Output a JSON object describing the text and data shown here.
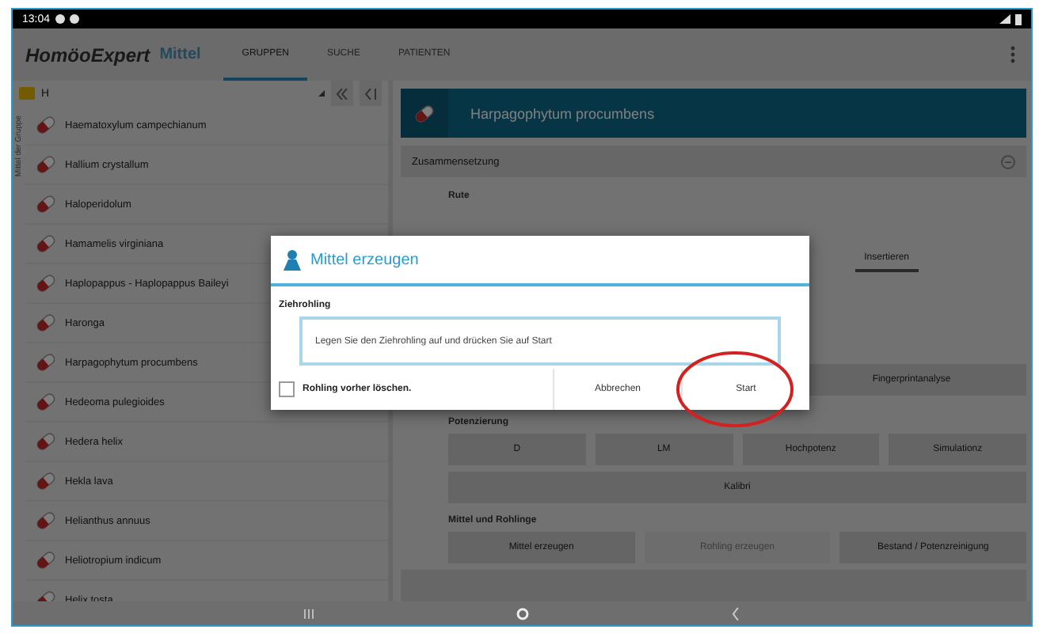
{
  "status_bar": {
    "time": "13:04"
  },
  "app_bar": {
    "logo": "HomöoExpert",
    "subtitle": "Mittel",
    "tabs": [
      {
        "label": "GRUPPEN",
        "selected": true
      },
      {
        "label": "SUCHE",
        "selected": false
      },
      {
        "label": "PATIENTEN",
        "selected": false
      }
    ]
  },
  "group_panel": {
    "side_label": "Mittel der Gruppe",
    "group": "H",
    "items": [
      {
        "label": "Haematoxylum campechianum"
      },
      {
        "label": "Hallium crystallum"
      },
      {
        "label": "Haloperidolum"
      },
      {
        "label": "Hamamelis virginiana"
      },
      {
        "label": "Haplopappus - Haplopappus Baileyi"
      },
      {
        "label": "Haronga"
      },
      {
        "label": "Harpagophytum procumbens"
      },
      {
        "label": "Hedeoma pulegioides"
      },
      {
        "label": "Hedera helix"
      },
      {
        "label": "Hekla lava"
      },
      {
        "label": "Helianthus annuus"
      },
      {
        "label": "Heliotropium indicum"
      },
      {
        "label": "Helix tosta"
      }
    ]
  },
  "detail": {
    "title": "Harpagophytum procumbens",
    "section": "Zusammensetzung",
    "field_label": "Rute",
    "tab": "Insertieren",
    "analysis_button": "Fingerprintanalyse",
    "potency_label": "Potenzierung",
    "potency_buttons": [
      "D",
      "LM",
      "Hochpotenz",
      "Simulationz"
    ],
    "wide_button": "Kalibri",
    "remedy_label": "Mittel und Rohlinge",
    "remedy_buttons": [
      {
        "label": "Mittel erzeugen",
        "disabled": false
      },
      {
        "label": "Rohling erzeugen",
        "disabled": true
      },
      {
        "label": "Bestand / Potenzreinigung",
        "disabled": false
      }
    ]
  },
  "dialog": {
    "title": "Mittel erzeugen",
    "field_label": "Ziehrohling",
    "field_value": "Legen Sie den Ziehrohling auf und drücken Sie auf Start",
    "checkbox": {
      "label": "Rohling vorher löschen.",
      "checked": false
    },
    "buttons": [
      {
        "label": "Abbrechen",
        "highlighted": false
      },
      {
        "label": "Start",
        "highlighted": true
      }
    ]
  }
}
